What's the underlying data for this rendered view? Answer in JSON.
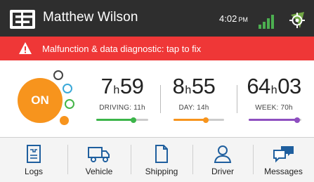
{
  "header": {
    "user_name": "Matthew Wilson",
    "time": "4:02",
    "ampm": "PM",
    "icons": [
      "logo-icon",
      "signal-icon",
      "gps-icon"
    ]
  },
  "alert": {
    "text": "Malfunction & data diagnostic: tap to fix",
    "icon": "warning-icon",
    "color": "#ef3737"
  },
  "duty_status": {
    "current": "ON",
    "color": "#f7941d",
    "options": [
      "off-duty",
      "sleeper",
      "driving",
      "on-duty"
    ]
  },
  "timers": [
    {
      "hours": "7",
      "minutes": "59",
      "unit": "h",
      "label": "DRIVING: 11h",
      "progress": 0.72,
      "color": "#3cb54a"
    },
    {
      "hours": "8",
      "minutes": "55",
      "unit": "h",
      "label": "DAY: 14h",
      "progress": 0.64,
      "color": "#f7941d"
    },
    {
      "hours": "64",
      "minutes": "03",
      "unit": "h",
      "label": "WEEK: 70h",
      "progress": 0.92,
      "color": "#8e4fc0"
    }
  ],
  "nav": [
    {
      "label": "Logs",
      "icon": "logs-icon"
    },
    {
      "label": "Vehicle",
      "icon": "truck-icon"
    },
    {
      "label": "Shipping",
      "icon": "document-icon"
    },
    {
      "label": "Driver",
      "icon": "person-icon"
    },
    {
      "label": "Messages",
      "icon": "messages-icon"
    }
  ]
}
